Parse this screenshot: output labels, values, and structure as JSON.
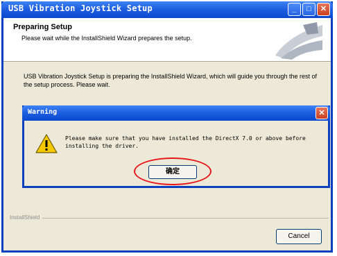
{
  "window": {
    "title": "USB Vibration Joystick Setup",
    "minimize_glyph": "_",
    "maximize_glyph": "□",
    "close_glyph": "✕"
  },
  "header": {
    "title": "Preparing Setup",
    "subtitle": "Please wait while the InstallShield Wizard prepares the setup."
  },
  "body": {
    "text": "USB Vibration Joystick Setup is preparing the InstallShield Wizard, which will guide you through the rest of the setup process. Please wait."
  },
  "footer": {
    "group_label": "InstallShield",
    "cancel_label": "Cancel"
  },
  "dialog": {
    "title": "Warning",
    "close_glyph": "✕",
    "message": "Please make sure that you have installed the DirectX 7.0 or above before installing the driver.",
    "ok_label": "确定",
    "icon": "warning-triangle-icon"
  },
  "colors": {
    "titlebar": "#0a48d0",
    "window_bg": "#ece9d8",
    "highlight": "#e8161a",
    "warning_icon": "#f6c800"
  }
}
